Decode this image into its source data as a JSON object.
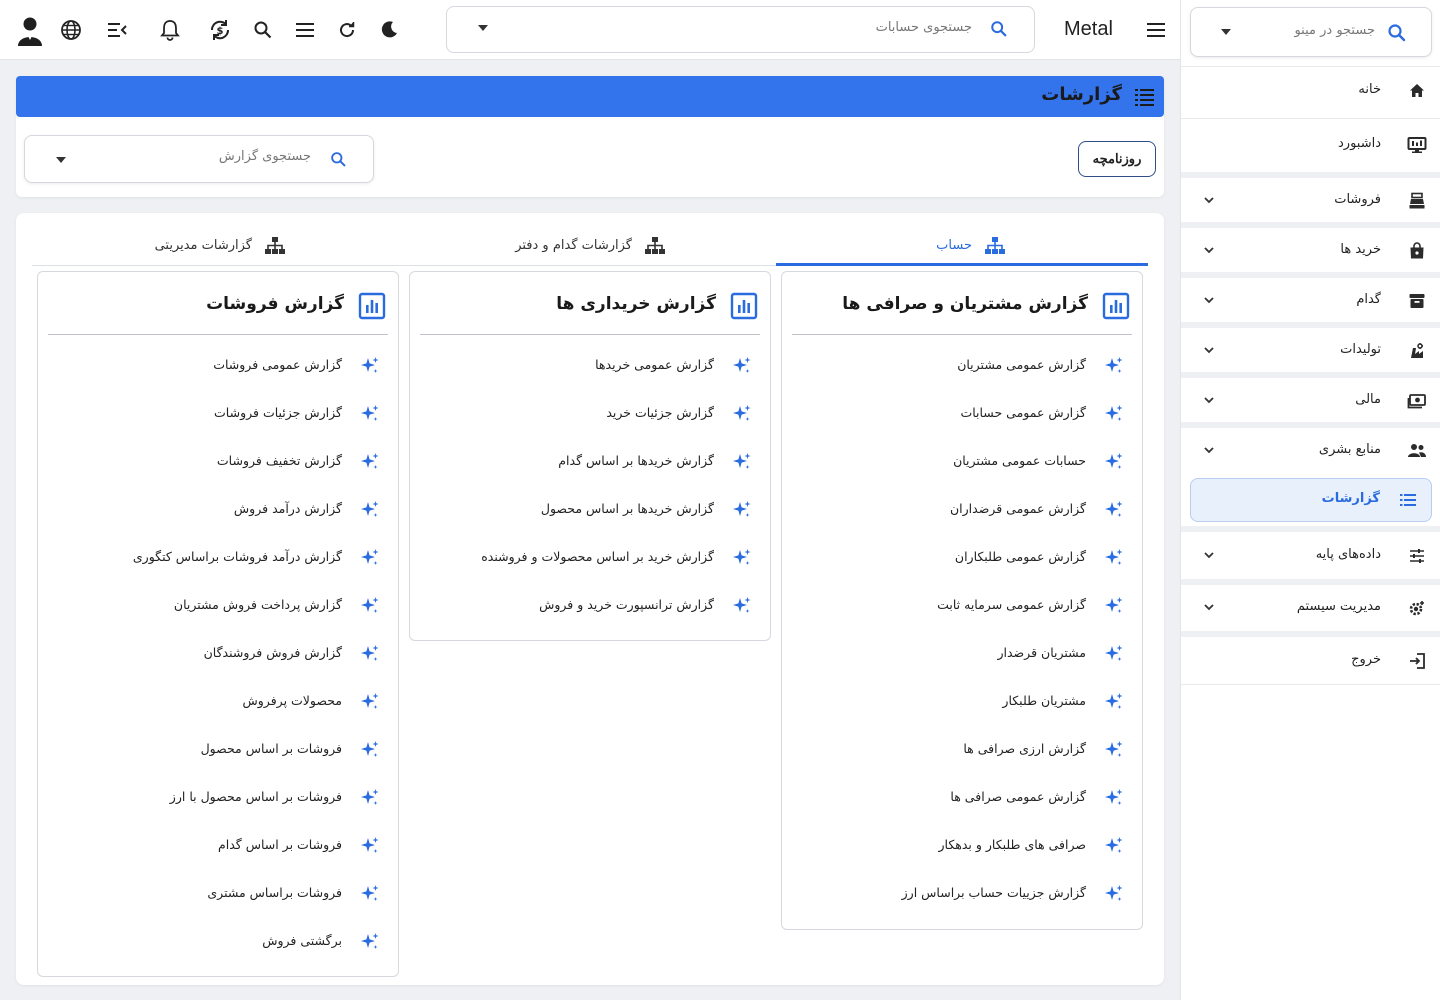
{
  "topbar": {
    "brand": "Metal",
    "search_placeholder": "جستجوی حسابات"
  },
  "sidebar": {
    "search_placeholder": "جستجو در مینو",
    "items": [
      {
        "label": "خانه",
        "icon": "home-icon",
        "expandable": false
      },
      {
        "label": "داشبورد",
        "icon": "monitor-icon",
        "expandable": false
      },
      {
        "label": "فروشات",
        "icon": "cash-register-icon",
        "expandable": true
      },
      {
        "label": "خرید ها",
        "icon": "shopping-bag-icon",
        "expandable": true
      },
      {
        "label": "گدام",
        "icon": "archive-icon",
        "expandable": true
      },
      {
        "label": "تولیدات",
        "icon": "factory-icon",
        "expandable": true
      },
      {
        "label": "مالی",
        "icon": "money-icon",
        "expandable": true
      },
      {
        "label": "منابع بشری",
        "icon": "people-icon",
        "expandable": true
      },
      {
        "label": "گزارشات",
        "icon": "list-icon",
        "active": true
      },
      {
        "label": "داده‌های پایه",
        "icon": "sliders-icon",
        "expandable": true
      },
      {
        "label": "مدیریت سیستم",
        "icon": "settings-gear-icon",
        "expandable": true
      },
      {
        "label": "خروج",
        "icon": "logout-icon",
        "expandable": false
      }
    ]
  },
  "page": {
    "title": "گزارشات",
    "journal_button": "روزنامچه",
    "report_search_placeholder": "جستجوی گزارش"
  },
  "tabs": [
    {
      "label": "حساب",
      "active": true
    },
    {
      "label": "گزارشات گدام و دفتر",
      "active": false
    },
    {
      "label": "گزارشات مدیریتی",
      "active": false
    }
  ],
  "columns": [
    {
      "title": "گزارش مشتریان و صرافی ها",
      "items": [
        "گزارش عمومی مشتریان",
        "گزارش عمومی حسابات",
        "حسابات عمومی مشتریان",
        "گزارش عمومی قرضداران",
        "گزارش عمومی طلبکاران",
        "گزارش عمومی سرمایه ثابت",
        "مشتریان قرضدار",
        "مشتریان طلبکار",
        "گزارش ارزی صرافی ها",
        "گزارش عمومی صرافی ها",
        "صرافی های طلبکار و بدهکار",
        "گزارش جزییات حساب براساس ارز"
      ]
    },
    {
      "title": "گزارش خریداری ها",
      "items": [
        "گزارش عمومی خریدها",
        "گزارش جزئیات خرید",
        "گزارش خریدها بر اساس گدام",
        "گزارش خریدها بر اساس محصول",
        "گزارش خرید بر اساس محصولات و فروشنده",
        "گزارش ترانسپورت خرید و فروش"
      ]
    },
    {
      "title": "گزارش فروشات",
      "items": [
        "گزارش عمومی فروشات",
        "گزارش جزئیات فروشات",
        "گزارش تخفیف فروشات",
        "گزارش درآمد فروش",
        "گزارش درآمد فروشات براساس کتگوری",
        "گزارش پرداخت فروش مشتریان",
        "گزارش فروش فروشندگان",
        "محصولات پرفروش",
        "فروشات بر اساس محصول",
        "فروشات بر اساس محصول با ارز",
        "فروشات بر اساس گدام",
        "فروشات براساس مشتری",
        "برگشتی فروش"
      ]
    }
  ],
  "colors": {
    "accent": "#3373eb",
    "link_blue": "#2a6be0"
  }
}
